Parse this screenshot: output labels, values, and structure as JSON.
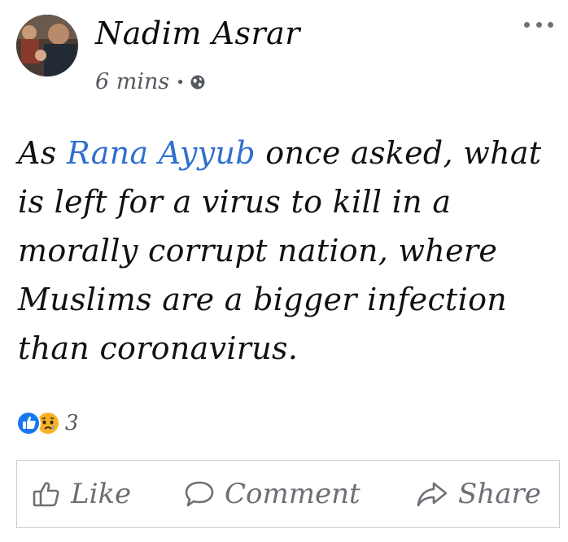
{
  "post": {
    "author": "Nadim Asrar",
    "time": "6 mins",
    "separator": "•",
    "privacy_icon": "globe-icon",
    "menu_icon": "more-options-icon",
    "text": {
      "prefix": "As ",
      "mention": "Rana Ayyub",
      "body": " once asked, what is left for a virus to kill in a morally corrupt nation, where Muslims are a bigger infection than coronavirus."
    },
    "reactions": {
      "icons": [
        "like-reaction-icon",
        "sad-reaction-icon"
      ],
      "count": "3"
    },
    "actions": {
      "like": "Like",
      "comment": "Comment",
      "share": "Share"
    }
  },
  "colors": {
    "mention": "#2f6fcf",
    "secondary_text": "#555a60",
    "like_blue": "#1877f2",
    "sad_yellow": "#f7b125"
  }
}
